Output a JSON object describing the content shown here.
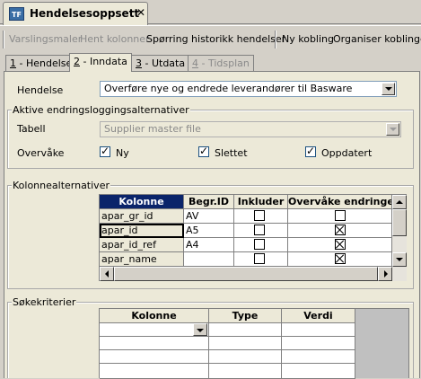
{
  "window_tab": {
    "icon_text": "TF",
    "title": "Hendelsesoppsett",
    "close": "✕"
  },
  "toolbar": {
    "varslingsmaler": "Varslingsmaler",
    "hent_kolonner": "Hent kolonner",
    "sporring": "Spørring historikk hendelser",
    "ny_kobling": "Ny kobling",
    "organiser": "Organiser koblinger"
  },
  "tabs": [
    {
      "num": "1",
      "label": " - Hendelse"
    },
    {
      "num": "2",
      "label": " - Inndata"
    },
    {
      "num": "3",
      "label": " - Utdata"
    },
    {
      "num": "4",
      "label": " - Tidsplan"
    }
  ],
  "hendelse": {
    "label": "Hendelse",
    "value": "Overføre nye og endrede leverandører til Basware"
  },
  "endring": {
    "group_title": "Aktive endringsloggingsalternativer",
    "tabell_label": "Tabell",
    "tabell_value": "Supplier master file",
    "overvake_label": "Overvåke",
    "ny": "Ny",
    "slettet": "Slettet",
    "oppdatert": "Oppdatert"
  },
  "kolonne": {
    "group_title": "Kolonnealternativer",
    "headers": [
      "Kolonne",
      "Begr.ID",
      "Inkluder",
      "Overvåke endringer"
    ],
    "rows": [
      {
        "kolonne": "apar_gr_id",
        "begr": "AV",
        "inkluder": false,
        "overvake": false
      },
      {
        "kolonne": "apar_id",
        "begr": "A5",
        "inkluder": false,
        "overvake": true
      },
      {
        "kolonne": "apar_id_ref",
        "begr": "A4",
        "inkluder": false,
        "overvake": true
      },
      {
        "kolonne": "apar_name",
        "begr": "",
        "inkluder": false,
        "overvake": true
      }
    ]
  },
  "soke": {
    "group_title": "Søkekriterier",
    "headers": [
      "Kolonne",
      "Type",
      "Verdi"
    ]
  }
}
